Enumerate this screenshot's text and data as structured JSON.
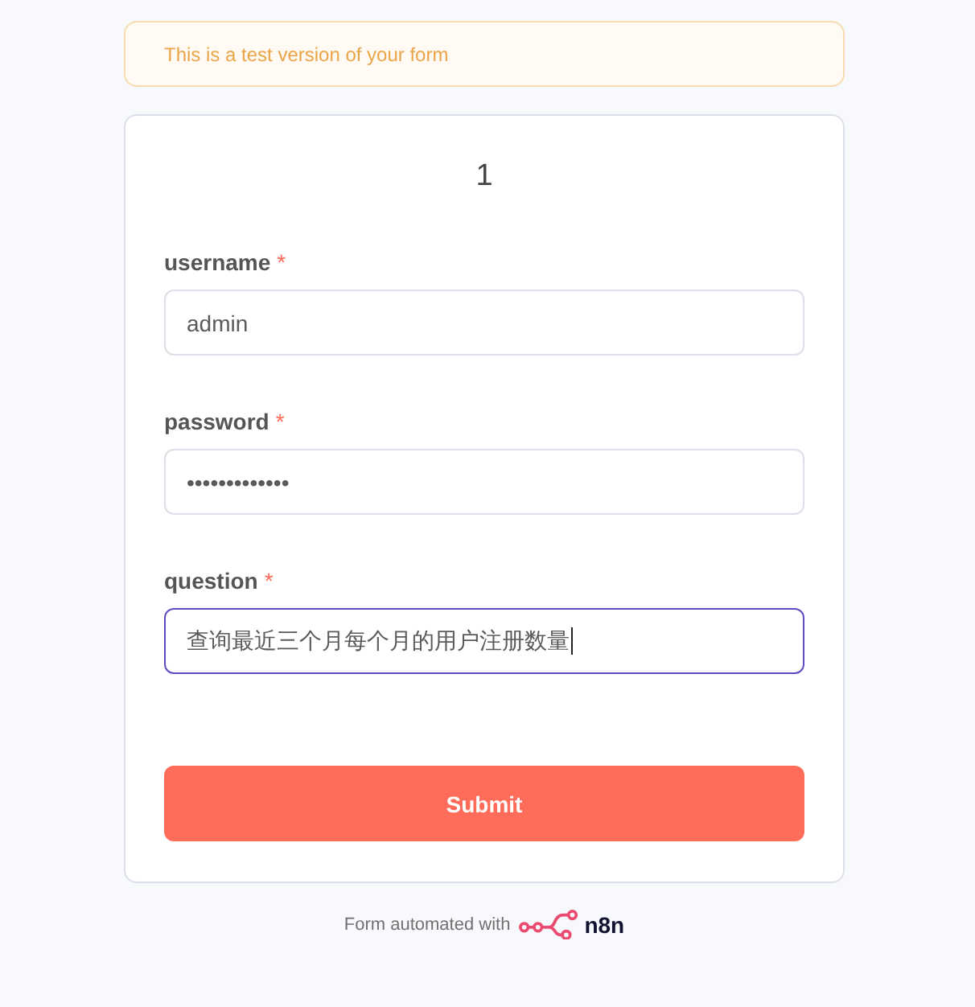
{
  "banner": {
    "text": "This is a test version of your form"
  },
  "form": {
    "title": "1",
    "fields": [
      {
        "label": "username",
        "required_mark": "*",
        "value": "admin",
        "focused": false
      },
      {
        "label": "password",
        "required_mark": "*",
        "value": "•••••••••••••",
        "focused": false
      },
      {
        "label": "question",
        "required_mark": "*",
        "value": "查询最近三个月每个月的用户注册数量",
        "focused": true
      }
    ],
    "submit": {
      "label": "Submit"
    }
  },
  "footer": {
    "text": "Form automated with",
    "brand": "n8n"
  }
}
